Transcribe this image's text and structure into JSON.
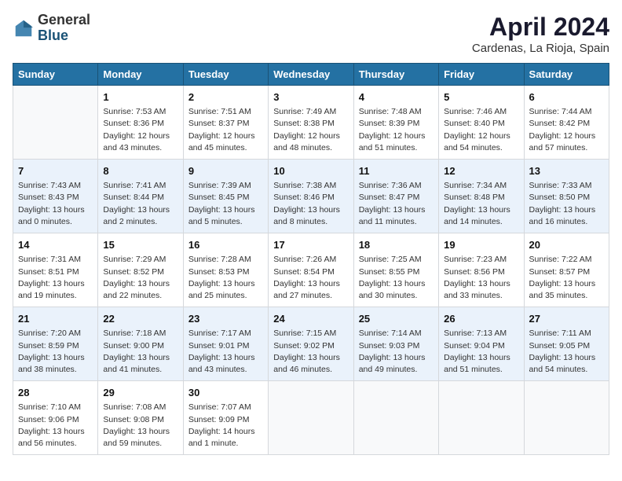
{
  "header": {
    "logo": {
      "line1": "General",
      "line2": "Blue"
    },
    "title": "April 2024",
    "location": "Cardenas, La Rioja, Spain"
  },
  "days_of_week": [
    "Sunday",
    "Monday",
    "Tuesday",
    "Wednesday",
    "Thursday",
    "Friday",
    "Saturday"
  ],
  "weeks": [
    [
      {
        "day": "",
        "info": ""
      },
      {
        "day": "1",
        "info": "Sunrise: 7:53 AM\nSunset: 8:36 PM\nDaylight: 12 hours\nand 43 minutes."
      },
      {
        "day": "2",
        "info": "Sunrise: 7:51 AM\nSunset: 8:37 PM\nDaylight: 12 hours\nand 45 minutes."
      },
      {
        "day": "3",
        "info": "Sunrise: 7:49 AM\nSunset: 8:38 PM\nDaylight: 12 hours\nand 48 minutes."
      },
      {
        "day": "4",
        "info": "Sunrise: 7:48 AM\nSunset: 8:39 PM\nDaylight: 12 hours\nand 51 minutes."
      },
      {
        "day": "5",
        "info": "Sunrise: 7:46 AM\nSunset: 8:40 PM\nDaylight: 12 hours\nand 54 minutes."
      },
      {
        "day": "6",
        "info": "Sunrise: 7:44 AM\nSunset: 8:42 PM\nDaylight: 12 hours\nand 57 minutes."
      }
    ],
    [
      {
        "day": "7",
        "info": "Sunrise: 7:43 AM\nSunset: 8:43 PM\nDaylight: 13 hours\nand 0 minutes."
      },
      {
        "day": "8",
        "info": "Sunrise: 7:41 AM\nSunset: 8:44 PM\nDaylight: 13 hours\nand 2 minutes."
      },
      {
        "day": "9",
        "info": "Sunrise: 7:39 AM\nSunset: 8:45 PM\nDaylight: 13 hours\nand 5 minutes."
      },
      {
        "day": "10",
        "info": "Sunrise: 7:38 AM\nSunset: 8:46 PM\nDaylight: 13 hours\nand 8 minutes."
      },
      {
        "day": "11",
        "info": "Sunrise: 7:36 AM\nSunset: 8:47 PM\nDaylight: 13 hours\nand 11 minutes."
      },
      {
        "day": "12",
        "info": "Sunrise: 7:34 AM\nSunset: 8:48 PM\nDaylight: 13 hours\nand 14 minutes."
      },
      {
        "day": "13",
        "info": "Sunrise: 7:33 AM\nSunset: 8:50 PM\nDaylight: 13 hours\nand 16 minutes."
      }
    ],
    [
      {
        "day": "14",
        "info": "Sunrise: 7:31 AM\nSunset: 8:51 PM\nDaylight: 13 hours\nand 19 minutes."
      },
      {
        "day": "15",
        "info": "Sunrise: 7:29 AM\nSunset: 8:52 PM\nDaylight: 13 hours\nand 22 minutes."
      },
      {
        "day": "16",
        "info": "Sunrise: 7:28 AM\nSunset: 8:53 PM\nDaylight: 13 hours\nand 25 minutes."
      },
      {
        "day": "17",
        "info": "Sunrise: 7:26 AM\nSunset: 8:54 PM\nDaylight: 13 hours\nand 27 minutes."
      },
      {
        "day": "18",
        "info": "Sunrise: 7:25 AM\nSunset: 8:55 PM\nDaylight: 13 hours\nand 30 minutes."
      },
      {
        "day": "19",
        "info": "Sunrise: 7:23 AM\nSunset: 8:56 PM\nDaylight: 13 hours\nand 33 minutes."
      },
      {
        "day": "20",
        "info": "Sunrise: 7:22 AM\nSunset: 8:57 PM\nDaylight: 13 hours\nand 35 minutes."
      }
    ],
    [
      {
        "day": "21",
        "info": "Sunrise: 7:20 AM\nSunset: 8:59 PM\nDaylight: 13 hours\nand 38 minutes."
      },
      {
        "day": "22",
        "info": "Sunrise: 7:18 AM\nSunset: 9:00 PM\nDaylight: 13 hours\nand 41 minutes."
      },
      {
        "day": "23",
        "info": "Sunrise: 7:17 AM\nSunset: 9:01 PM\nDaylight: 13 hours\nand 43 minutes."
      },
      {
        "day": "24",
        "info": "Sunrise: 7:15 AM\nSunset: 9:02 PM\nDaylight: 13 hours\nand 46 minutes."
      },
      {
        "day": "25",
        "info": "Sunrise: 7:14 AM\nSunset: 9:03 PM\nDaylight: 13 hours\nand 49 minutes."
      },
      {
        "day": "26",
        "info": "Sunrise: 7:13 AM\nSunset: 9:04 PM\nDaylight: 13 hours\nand 51 minutes."
      },
      {
        "day": "27",
        "info": "Sunrise: 7:11 AM\nSunset: 9:05 PM\nDaylight: 13 hours\nand 54 minutes."
      }
    ],
    [
      {
        "day": "28",
        "info": "Sunrise: 7:10 AM\nSunset: 9:06 PM\nDaylight: 13 hours\nand 56 minutes."
      },
      {
        "day": "29",
        "info": "Sunrise: 7:08 AM\nSunset: 9:08 PM\nDaylight: 13 hours\nand 59 minutes."
      },
      {
        "day": "30",
        "info": "Sunrise: 7:07 AM\nSunset: 9:09 PM\nDaylight: 14 hours\nand 1 minute."
      },
      {
        "day": "",
        "info": ""
      },
      {
        "day": "",
        "info": ""
      },
      {
        "day": "",
        "info": ""
      },
      {
        "day": "",
        "info": ""
      }
    ]
  ]
}
